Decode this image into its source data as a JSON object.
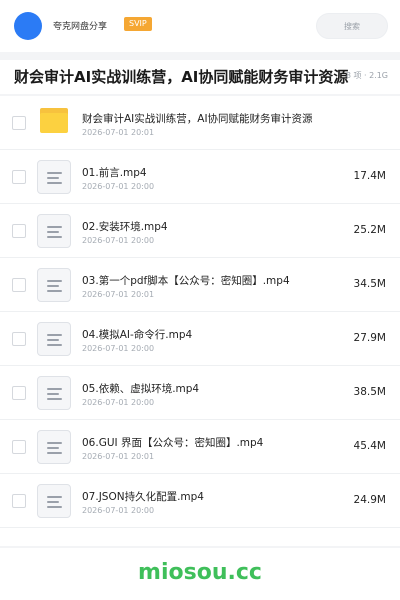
{
  "header": {
    "site_name": "夸克网盘分享",
    "badge": "SVIP",
    "search_placeholder": "搜索"
  },
  "title_bar": {
    "title": "财会审计AI实战训练营，AI协同赋能财务审计资源",
    "summary": "8 项 · 2.1G"
  },
  "files": [
    {
      "name": "财会审计AI实战训练营，AI协同赋能财务审计资源",
      "time": "2026-07-01 20:01",
      "size": "",
      "type": "folder"
    },
    {
      "name": "01.前言.mp4",
      "time": "2026-07-01 20:00",
      "size": "17.4M",
      "type": "file"
    },
    {
      "name": "02.安装环境.mp4",
      "time": "2026-07-01 20:00",
      "size": "25.2M",
      "type": "file"
    },
    {
      "name": "03.第一个pdf脚本【公众号：密知圈】.mp4",
      "time": "2026-07-01 20:01",
      "size": "34.5M",
      "type": "file"
    },
    {
      "name": "04.模拟AI-命令行.mp4",
      "time": "2026-07-01 20:00",
      "size": "27.9M",
      "type": "file"
    },
    {
      "name": "05.依赖、虚拟环境.mp4",
      "time": "2026-07-01 20:00",
      "size": "38.5M",
      "type": "file"
    },
    {
      "name": "06.GUI 界面【公众号：密知圈】.mp4",
      "time": "2026-07-01 20:01",
      "size": "45.4M",
      "type": "file"
    },
    {
      "name": "07.JSON持久化配置.mp4",
      "time": "2026-07-01 20:00",
      "size": "24.9M",
      "type": "file"
    }
  ],
  "footer": {
    "watermark": "miosou.cc"
  },
  "colors": {
    "accent": "#2b7bf5",
    "badge": "#f5a733",
    "folder": "#fcd140",
    "watermark": "#3fbf5a"
  }
}
